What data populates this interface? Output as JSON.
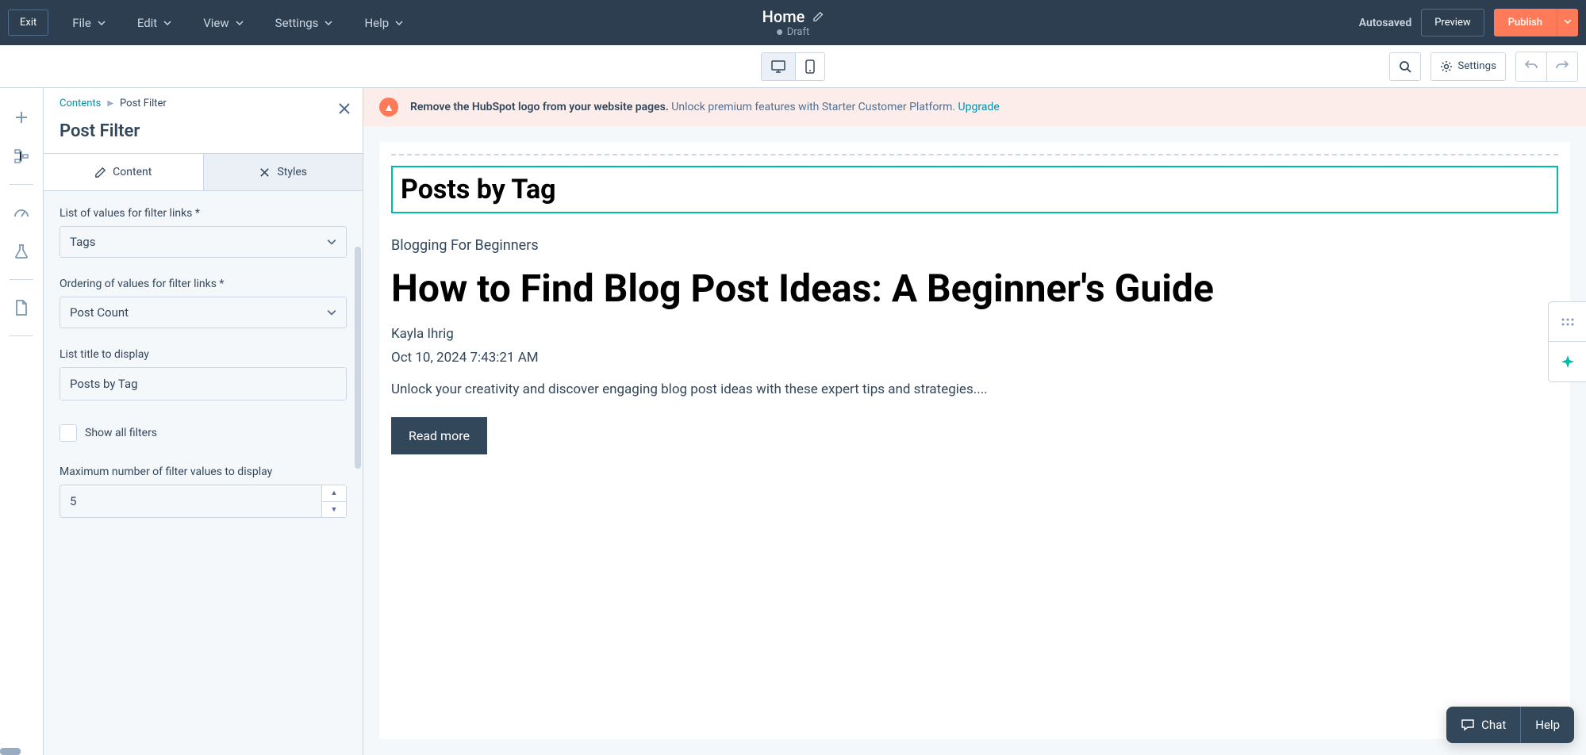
{
  "toolbar": {
    "exit": "Exit",
    "menu": {
      "file": "File",
      "edit": "Edit",
      "view": "View",
      "settings": "Settings",
      "help": "Help"
    },
    "page_title": "Home",
    "draft": "Draft",
    "autosaved": "Autosaved",
    "preview": "Preview",
    "publish": "Publish"
  },
  "second_bar": {
    "settings": "Settings"
  },
  "panel": {
    "breadcrumb": {
      "root": "Contents",
      "current": "Post Filter"
    },
    "title": "Post Filter",
    "tabs": {
      "content": "Content",
      "styles": "Styles"
    },
    "fields": {
      "list_values_label": "List of values for filter links *",
      "list_values_value": "Tags",
      "ordering_label": "Ordering of values for filter links *",
      "ordering_value": "Post Count",
      "title_label": "List title to display",
      "title_value": "Posts by Tag",
      "show_filters": "Show all filters",
      "max_label": "Maximum number of filter values to display",
      "max_value": "5"
    }
  },
  "banner": {
    "bold": "Remove the HubSpot logo from your website pages.",
    "light": " Unlock premium features with Starter Customer Platform. ",
    "link": "Upgrade"
  },
  "content": {
    "selected_heading": "Posts by Tag",
    "category": "Blogging For Beginners",
    "headline": "How to Find Blog Post Ideas: A Beginner's Guide",
    "author": "Kayla Ihrig",
    "date": "Oct 10, 2024 7:43:21 AM",
    "excerpt": "Unlock your creativity and discover engaging blog post ideas with these expert tips and strategies....",
    "read_more": "Read more"
  },
  "chat": {
    "chat": "Chat",
    "help": "Help"
  }
}
